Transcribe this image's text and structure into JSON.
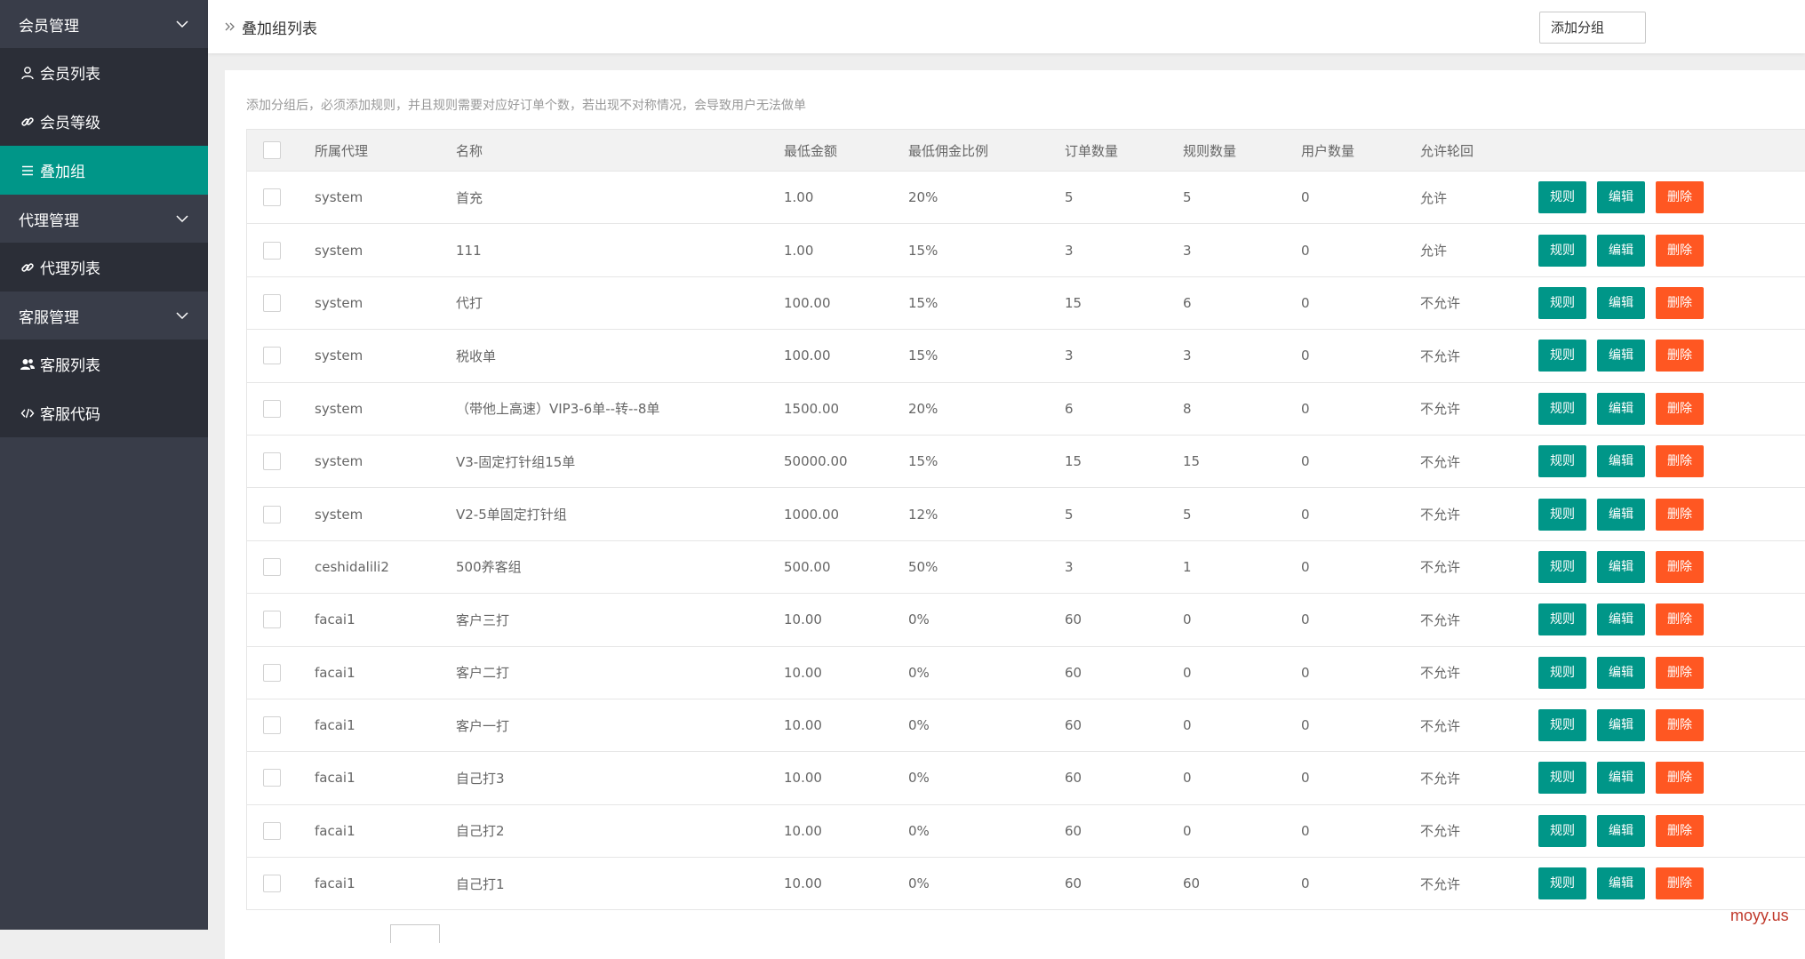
{
  "sidebar": {
    "groups": [
      {
        "label": "会员管理",
        "items": [
          {
            "label": "会员列表",
            "icon": "user-icon"
          },
          {
            "label": "会员等级",
            "icon": "link-icon"
          },
          {
            "label": "叠加组",
            "icon": "list-icon",
            "active": true
          }
        ]
      },
      {
        "label": "代理管理",
        "items": [
          {
            "label": "代理列表",
            "icon": "link-icon"
          }
        ]
      },
      {
        "label": "客服管理",
        "items": [
          {
            "label": "客服列表",
            "icon": "users-icon"
          },
          {
            "label": "客服代码",
            "icon": "code-icon"
          }
        ]
      }
    ]
  },
  "header": {
    "breadcrumb_title": "叠加组列表",
    "add_button_label": "添加分组"
  },
  "notice": "添加分组后，必须添加规则，并且规则需要对应好订单个数，若出现不对称情况，会导致用户无法做单",
  "table": {
    "columns": [
      "所属代理",
      "名称",
      "最低金额",
      "最低佣金比例",
      "订单数量",
      "规则数量",
      "用户数量",
      "允许轮回"
    ],
    "action_labels": {
      "rules": "规则",
      "edit": "编辑",
      "delete": "删除"
    },
    "rows": [
      {
        "agent": "system",
        "name": "首充",
        "min_amount": "1.00",
        "ratio": "20%",
        "orders": "5",
        "rules": "5",
        "users": "0",
        "allow": "允许"
      },
      {
        "agent": "system",
        "name": "111",
        "min_amount": "1.00",
        "ratio": "15%",
        "orders": "3",
        "rules": "3",
        "users": "0",
        "allow": "允许"
      },
      {
        "agent": "system",
        "name": "代打",
        "min_amount": "100.00",
        "ratio": "15%",
        "orders": "15",
        "rules": "6",
        "users": "0",
        "allow": "不允许"
      },
      {
        "agent": "system",
        "name": "税收单",
        "min_amount": "100.00",
        "ratio": "15%",
        "orders": "3",
        "rules": "3",
        "users": "0",
        "allow": "不允许"
      },
      {
        "agent": "system",
        "name": "（带他上高速）VIP3-6单--转--8单",
        "min_amount": "1500.00",
        "ratio": "20%",
        "orders": "6",
        "rules": "8",
        "users": "0",
        "allow": "不允许"
      },
      {
        "agent": "system",
        "name": "V3-固定打针组15单",
        "min_amount": "50000.00",
        "ratio": "15%",
        "orders": "15",
        "rules": "15",
        "users": "0",
        "allow": "不允许"
      },
      {
        "agent": "system",
        "name": "V2-5单固定打针组",
        "min_amount": "1000.00",
        "ratio": "12%",
        "orders": "5",
        "rules": "5",
        "users": "0",
        "allow": "不允许"
      },
      {
        "agent": "ceshidalili2",
        "name": "500养客组",
        "min_amount": "500.00",
        "ratio": "50%",
        "orders": "3",
        "rules": "1",
        "users": "0",
        "allow": "不允许"
      },
      {
        "agent": "facai1",
        "name": "客户三打",
        "min_amount": "10.00",
        "ratio": "0%",
        "orders": "60",
        "rules": "0",
        "users": "0",
        "allow": "不允许"
      },
      {
        "agent": "facai1",
        "name": "客户二打",
        "min_amount": "10.00",
        "ratio": "0%",
        "orders": "60",
        "rules": "0",
        "users": "0",
        "allow": "不允许"
      },
      {
        "agent": "facai1",
        "name": "客户一打",
        "min_amount": "10.00",
        "ratio": "0%",
        "orders": "60",
        "rules": "0",
        "users": "0",
        "allow": "不允许"
      },
      {
        "agent": "facai1",
        "name": "自己打3",
        "min_amount": "10.00",
        "ratio": "0%",
        "orders": "60",
        "rules": "0",
        "users": "0",
        "allow": "不允许"
      },
      {
        "agent": "facai1",
        "name": "自己打2",
        "min_amount": "10.00",
        "ratio": "0%",
        "orders": "60",
        "rules": "0",
        "users": "0",
        "allow": "不允许"
      },
      {
        "agent": "facai1",
        "name": "自己打1",
        "min_amount": "10.00",
        "ratio": "0%",
        "orders": "60",
        "rules": "60",
        "users": "0",
        "allow": "不允许"
      }
    ]
  },
  "watermark": "moyy.us",
  "colors": {
    "sidebar_bg": "#393d49",
    "submenu_bg": "#2b2e37",
    "accent": "#009688",
    "danger": "#ff5722"
  }
}
